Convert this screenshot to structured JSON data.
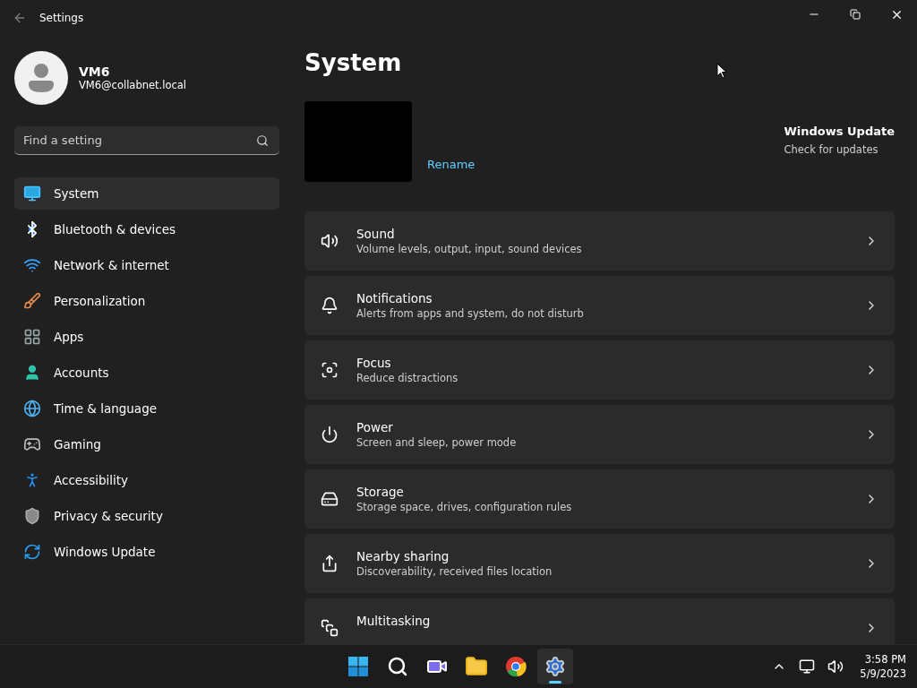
{
  "window": {
    "title": "Settings"
  },
  "user": {
    "name": "VM6",
    "email": "VM6@collabnet.local"
  },
  "search": {
    "placeholder": "Find a setting"
  },
  "sidebar": {
    "items": [
      {
        "label": "System",
        "selected": true
      },
      {
        "label": "Bluetooth & devices",
        "selected": false
      },
      {
        "label": "Network & internet",
        "selected": false
      },
      {
        "label": "Personalization",
        "selected": false
      },
      {
        "label": "Apps",
        "selected": false
      },
      {
        "label": "Accounts",
        "selected": false
      },
      {
        "label": "Time & language",
        "selected": false
      },
      {
        "label": "Gaming",
        "selected": false
      },
      {
        "label": "Accessibility",
        "selected": false
      },
      {
        "label": "Privacy & security",
        "selected": false
      },
      {
        "label": "Windows Update",
        "selected": false
      }
    ]
  },
  "page": {
    "title": "System",
    "rename": "Rename",
    "update": {
      "title": "Windows Update",
      "subtitle": "Check for updates"
    },
    "cards": [
      {
        "kind": "sound",
        "title": "Sound",
        "description": "Volume levels, output, input, sound devices"
      },
      {
        "kind": "notifications",
        "title": "Notifications",
        "description": "Alerts from apps and system, do not disturb"
      },
      {
        "kind": "focus",
        "title": "Focus",
        "description": "Reduce distractions"
      },
      {
        "kind": "power",
        "title": "Power",
        "description": "Screen and sleep, power mode"
      },
      {
        "kind": "storage",
        "title": "Storage",
        "description": "Storage space, drives, configuration rules"
      },
      {
        "kind": "sharing",
        "title": "Nearby sharing",
        "description": "Discoverability, received files location"
      },
      {
        "kind": "multitasking",
        "title": "Multitasking"
      }
    ]
  },
  "taskbar": {
    "apps": [
      {
        "kind": "start",
        "active": false
      },
      {
        "kind": "search",
        "active": false
      },
      {
        "kind": "chat",
        "active": false
      },
      {
        "kind": "explorer",
        "active": false
      },
      {
        "kind": "browser",
        "active": false
      },
      {
        "kind": "settings",
        "active": true
      }
    ],
    "time": "3:58 PM",
    "date": "5/9/2023"
  }
}
